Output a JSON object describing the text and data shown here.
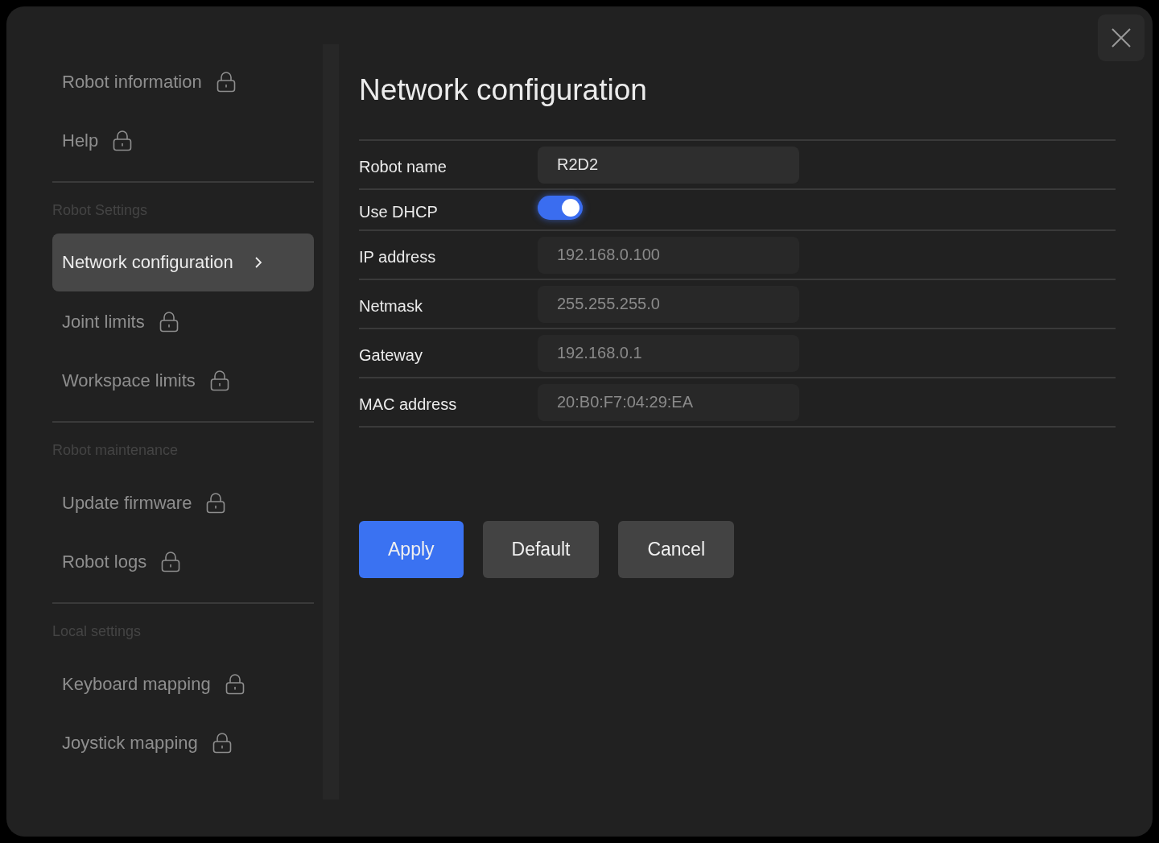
{
  "sidebar": {
    "sections": [
      {
        "items": [
          {
            "label": "Robot information",
            "selected": false,
            "locked": true
          },
          {
            "label": "Help",
            "selected": false,
            "locked": true
          }
        ]
      },
      {
        "heading": "Robot Settings",
        "items": [
          {
            "label": "Network configuration",
            "selected": true,
            "locked": false
          },
          {
            "label": "Joint limits",
            "selected": false,
            "locked": true
          },
          {
            "label": "Workspace limits",
            "selected": false,
            "locked": true
          }
        ]
      },
      {
        "heading": "Robot maintenance",
        "items": [
          {
            "label": "Update firmware",
            "selected": false,
            "locked": true
          },
          {
            "label": "Robot logs",
            "selected": false,
            "locked": true
          }
        ]
      },
      {
        "heading": "Local settings",
        "items": [
          {
            "label": "Keyboard mapping",
            "selected": false,
            "locked": true
          },
          {
            "label": "Joystick mapping",
            "selected": false,
            "locked": true
          }
        ]
      }
    ]
  },
  "page": {
    "title": "Network configuration",
    "fields": [
      {
        "kind": "text",
        "label": "Robot name",
        "value": "R2D2",
        "disabled": false
      },
      {
        "kind": "toggle",
        "label": "Use DHCP",
        "on": true
      },
      {
        "kind": "text",
        "label": "IP address",
        "value": "192.168.0.100",
        "disabled": true
      },
      {
        "kind": "text",
        "label": "Netmask",
        "value": "255.255.255.0",
        "disabled": true
      },
      {
        "kind": "text",
        "label": "Gateway",
        "value": "192.168.0.1",
        "disabled": true
      },
      {
        "kind": "text",
        "label": "MAC address",
        "value": "20:B0:F7:04:29:EA",
        "disabled": true
      }
    ],
    "buttons": [
      {
        "label": "Apply",
        "kind": "primary"
      },
      {
        "label": "Default",
        "kind": "secondary"
      },
      {
        "label": "Cancel",
        "kind": "secondary"
      }
    ]
  }
}
